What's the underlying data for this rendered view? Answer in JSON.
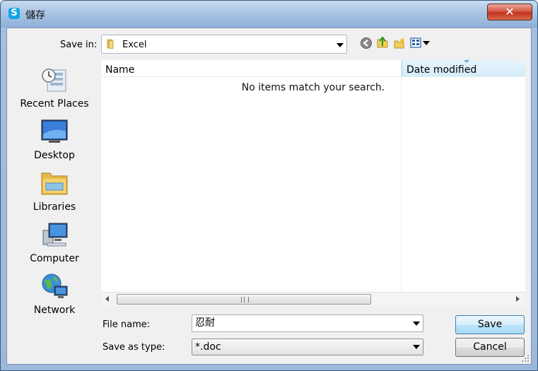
{
  "window": {
    "title": "儲存"
  },
  "save_in": {
    "label": "Save in:",
    "value": "Excel"
  },
  "places": [
    {
      "key": "recent",
      "label": "Recent Places"
    },
    {
      "key": "desktop",
      "label": "Desktop"
    },
    {
      "key": "libraries",
      "label": "Libraries"
    },
    {
      "key": "computer",
      "label": "Computer"
    },
    {
      "key": "network",
      "label": "Network"
    }
  ],
  "file_list": {
    "columns": [
      "Name",
      "Date modified"
    ],
    "empty_message": "No items match your search."
  },
  "file_name": {
    "label": "File name:",
    "value": "忍耐"
  },
  "save_as_type": {
    "label": "Save as type:",
    "value": "*.doc"
  },
  "buttons": {
    "save": "Save",
    "cancel": "Cancel"
  },
  "colors": {
    "accent": "#3c7fb1",
    "title_bar": "#a9c5e4",
    "close": "#c0331f"
  }
}
